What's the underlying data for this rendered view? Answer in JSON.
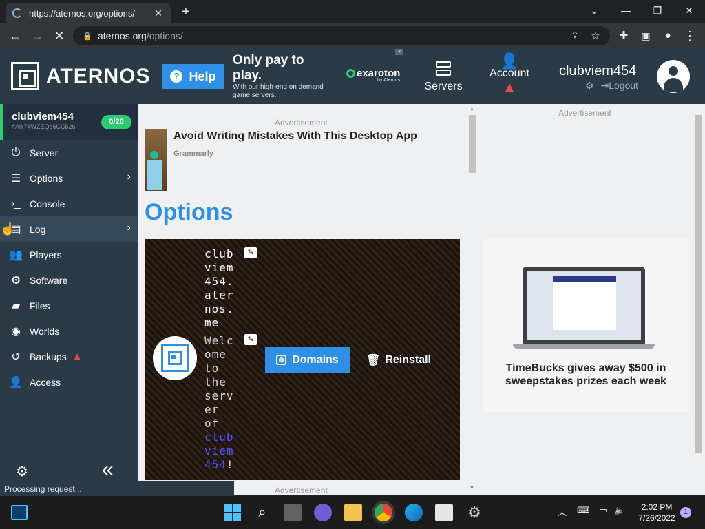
{
  "browser": {
    "tab_title": "https://aternos.org/options/",
    "url_host": "aternos.org",
    "url_path": "/options/"
  },
  "header": {
    "logo_text": "ATERNOS",
    "help_label": "Help",
    "ad": {
      "headline": "Only pay to play.",
      "subtext": "With our high-end on demand game servers.",
      "brand": "exaroton",
      "brand_sub": "by Aternos"
    },
    "servers_label": "Servers",
    "account_label": "Account",
    "username": "clubviem454",
    "logout_label": "Logout"
  },
  "sidebar": {
    "server_name": "clubviem454",
    "server_id": "#Aik74WZEQq6CC526",
    "player_badge": "0/20",
    "items": [
      {
        "label": "Server",
        "icon": "power-icon"
      },
      {
        "label": "Options",
        "icon": "sliders-icon"
      },
      {
        "label": "Console",
        "icon": "terminal-icon"
      },
      {
        "label": "Log",
        "icon": "file-icon"
      },
      {
        "label": "Players",
        "icon": "users-icon"
      },
      {
        "label": "Software",
        "icon": "cogs-icon"
      },
      {
        "label": "Files",
        "icon": "folder-icon"
      },
      {
        "label": "Worlds",
        "icon": "globe-icon"
      },
      {
        "label": "Backups",
        "icon": "history-icon"
      },
      {
        "label": "Access",
        "icon": "user-lock-icon"
      }
    ]
  },
  "main": {
    "ad_label_top": "Advertisement",
    "ad_title": "Avoid Writing Mistakes With This Desktop App",
    "ad_brand": "Grammarly",
    "page_title": "Options",
    "server_address": "club\nviem\n454.\nater\nnos.\nme",
    "motd_plain": "Welc\nome\nto\nthe\nserv\ner\nof",
    "motd_name": "club\nviem\n454",
    "motd_end": "!",
    "domains_label": "Domains",
    "reinstall_label": "Reinstall",
    "ad_label_bottom": "Advertisement"
  },
  "right_ad": {
    "label": "Advertisement",
    "caption": "TimeBucks gives away $500 in sweepstakes prizes each week"
  },
  "status": {
    "text": "Processing request..."
  },
  "taskbar": {
    "time": "2:02 PM",
    "date": "7/26/2022",
    "notifications": "1"
  },
  "colors": {
    "brand_blue": "#2e8fe6",
    "sidebar_bg": "#2b3a47",
    "online_green": "#2ecc71",
    "warning_red": "#e74c3c"
  }
}
